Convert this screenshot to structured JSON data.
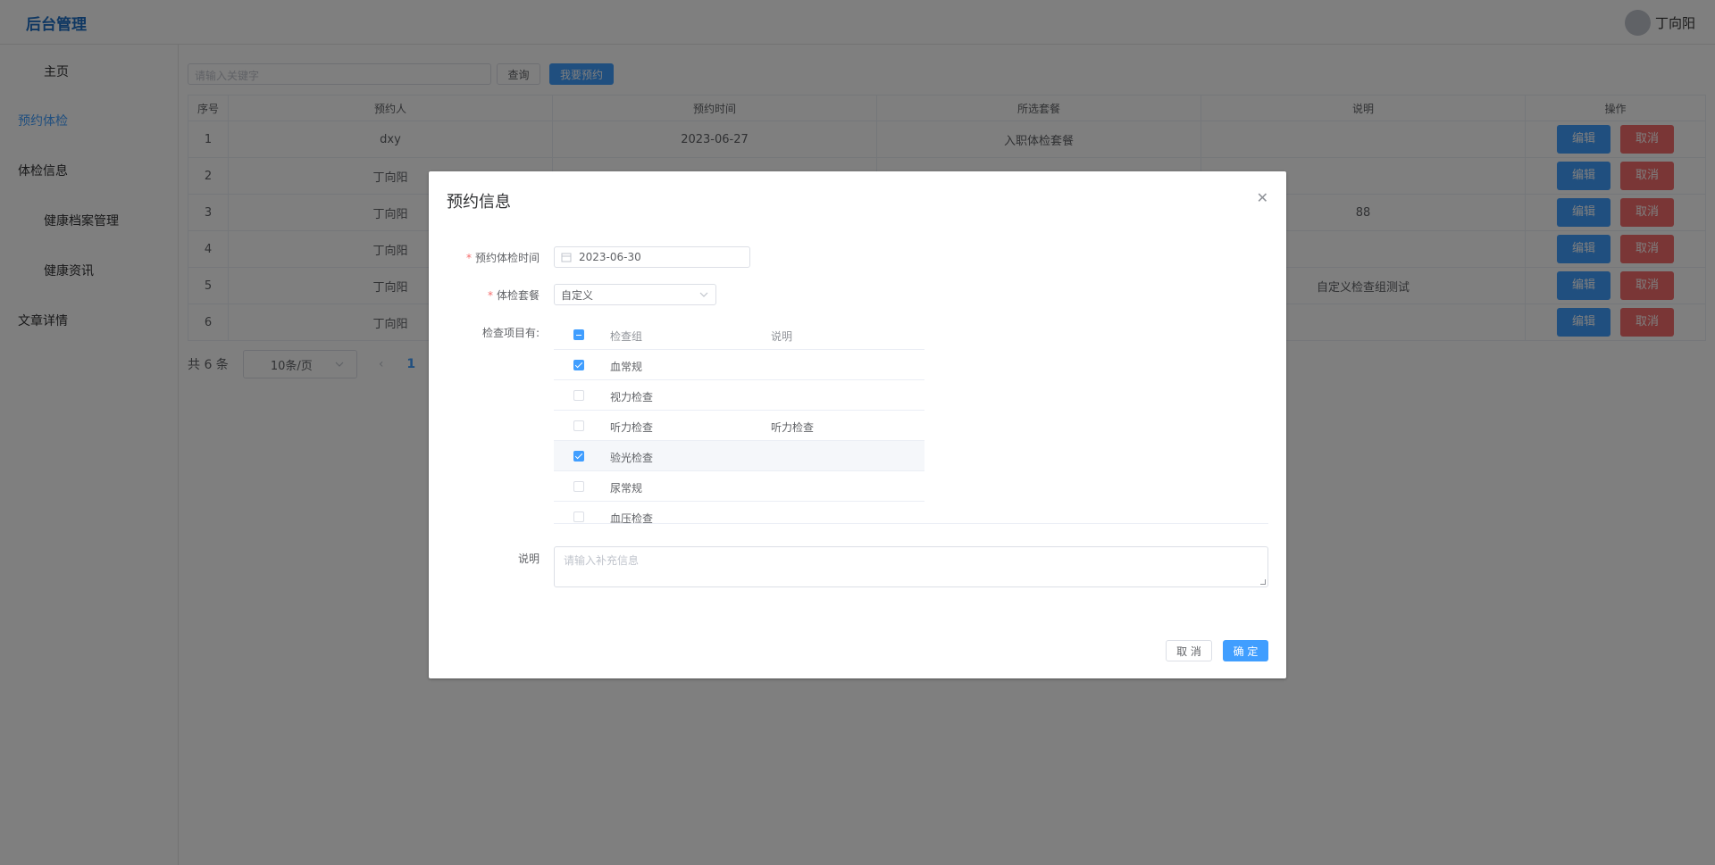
{
  "header": {
    "brand": "后台管理",
    "username": "丁向阳"
  },
  "sidebar": {
    "items": [
      {
        "label": "主页"
      },
      {
        "label": "预约体检"
      },
      {
        "label": "体检信息"
      },
      {
        "label": "健康档案管理"
      },
      {
        "label": "健康资讯"
      },
      {
        "label": "文章详情"
      }
    ]
  },
  "main": {
    "search_placeholder": "请输入关键字",
    "query_label": "查询",
    "book_label": "我要预约",
    "columns": [
      "序号",
      "预约人",
      "预约时间",
      "所选套餐",
      "说明",
      "操作"
    ],
    "rows": [
      {
        "no": "1",
        "person": "dxy",
        "time": "2023-06-27",
        "package": "入职体检套餐",
        "note": ""
      },
      {
        "no": "2",
        "person": "丁向阳",
        "time": "",
        "package": "",
        "note": ""
      },
      {
        "no": "3",
        "person": "丁向阳",
        "time": "",
        "package": "",
        "note": "88"
      },
      {
        "no": "4",
        "person": "丁向阳",
        "time": "",
        "package": "",
        "note": ""
      },
      {
        "no": "5",
        "person": "丁向阳",
        "time": "",
        "package": "",
        "note": "自定义检查组测试"
      },
      {
        "no": "6",
        "person": "丁向阳",
        "time": "",
        "package": "",
        "note": ""
      }
    ],
    "edit_label": "编辑",
    "cancel_label": "取消",
    "pager": {
      "total": "共 6 条",
      "size": "10条/页",
      "current": "1"
    }
  },
  "dialog": {
    "title": "预约信息",
    "date_label": "预约体检时间",
    "date_value": "2023-06-30",
    "package_label": "体检套餐",
    "package_value": "自定义",
    "items_label": "检查项目有:",
    "items_header": {
      "name": "检查组",
      "desc": "说明"
    },
    "items": [
      {
        "name": "血常规",
        "desc": "",
        "checked": true
      },
      {
        "name": "视力检查",
        "desc": "",
        "checked": false
      },
      {
        "name": "听力检查",
        "desc": "听力检查",
        "checked": false
      },
      {
        "name": "验光检查",
        "desc": "",
        "checked": true
      },
      {
        "name": "尿常规",
        "desc": "",
        "checked": false
      },
      {
        "name": "血压检查",
        "desc": "",
        "checked": false
      }
    ],
    "note_label": "说明",
    "note_placeholder": "请输入补充信息",
    "cancel_label": "取 消",
    "ok_label": "确 定"
  },
  "colors": {
    "primary": "#409eff",
    "danger": "#f56c6c",
    "brand": "#1e6fc4"
  }
}
